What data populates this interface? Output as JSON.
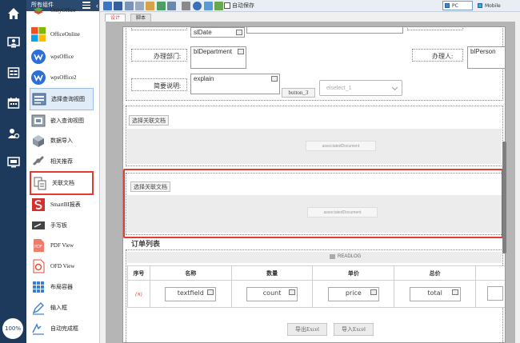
{
  "panel": {
    "title": "所有组件",
    "items": [
      {
        "label": "OnlyOffice",
        "icon": "onlyoffice-icon"
      },
      {
        "label": "OfficeOnline",
        "icon": "microsoft-icon"
      },
      {
        "label": "wpsOffice",
        "icon": "wps-icon"
      },
      {
        "label": "wpsOffice2",
        "icon": "wps-icon"
      },
      {
        "label": "选择查询视图",
        "icon": "select-view-icon"
      },
      {
        "label": "嵌入查询视图",
        "icon": "embed-view-icon"
      },
      {
        "label": "数据导入",
        "icon": "data-import-icon"
      },
      {
        "label": "相关推荐",
        "icon": "related-icon"
      },
      {
        "label": "关联文档",
        "icon": "associated-doc-icon"
      },
      {
        "label": "SmartBI报表",
        "icon": "smartbi-icon"
      },
      {
        "label": "手写板",
        "icon": "handwriting-icon"
      },
      {
        "label": "PDF View",
        "icon": "pdf-icon"
      },
      {
        "label": "OFD View",
        "icon": "ofd-icon"
      },
      {
        "label": "布局容器",
        "icon": "layout-container-icon"
      },
      {
        "label": "输入框",
        "icon": "input-box-icon"
      },
      {
        "label": "自动完成框",
        "icon": "autocomplete-icon"
      }
    ]
  },
  "zoom": "100%",
  "toolbar": {
    "autosave_label": "自动保存",
    "view_pc": "PC",
    "view_mobile": "Mobile"
  },
  "tabs": [
    {
      "label": "设计"
    },
    {
      "label": "脚本"
    }
  ],
  "form": {
    "date_field": "slDate",
    "dept_label": "办理部门:",
    "dept_field": "blDepartment",
    "person_label": "办理人:",
    "person_field": "blPerson",
    "summary_label": "简要说明:",
    "summary_field": "explain",
    "button3": "button_3",
    "select_placeholder": "elselect_1"
  },
  "assoc1": {
    "button": "选择关联文档",
    "chip": "associatedDocument"
  },
  "assoc2": {
    "button": "选择关联文档",
    "chip": "associatedDocument"
  },
  "order": {
    "title": "订单列表",
    "readlog": "READLOG",
    "headers": [
      "序号",
      "名称",
      "数量",
      "单价",
      "总价"
    ],
    "row": {
      "num": "{N}",
      "name": "textfield",
      "count": "count",
      "price": "price",
      "total": "total"
    },
    "export": "导出Excel",
    "import": "导入Excel"
  },
  "colors": {
    "accent": "#e33b2e",
    "nav": "#1d3a5c"
  }
}
